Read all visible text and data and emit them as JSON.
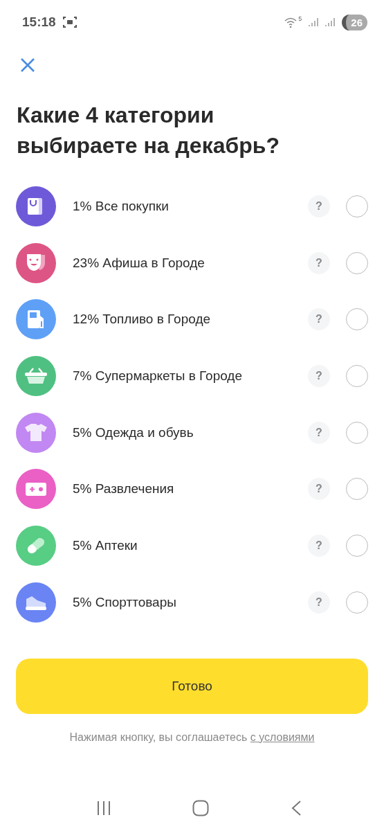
{
  "status_bar": {
    "time": "15:18",
    "network_badge": "5",
    "battery": "26"
  },
  "title": "Какие 4 категории выбираете на декабрь?",
  "categories": [
    {
      "kind": "bag",
      "color": "#6e5ad8",
      "label": "1% Все покупки",
      "help": "?",
      "selected": false
    },
    {
      "kind": "mask",
      "color": "#dd5585",
      "label": "23% Афиша в Городе",
      "help": "?",
      "selected": false
    },
    {
      "kind": "fuel",
      "color": "#5fa0f7",
      "label": "12% Топливо в Городе",
      "help": "?",
      "selected": false
    },
    {
      "kind": "basket",
      "color": "#4fc081",
      "label": "7% Супермаркеты в Городе",
      "help": "?",
      "selected": false
    },
    {
      "kind": "shirt",
      "color": "#c187f2",
      "label": "5% Одежда и обувь",
      "help": "?",
      "selected": false
    },
    {
      "kind": "gamepad",
      "color": "#ea60c5",
      "label": "5% Развлечения",
      "help": "?",
      "selected": false
    },
    {
      "kind": "pill",
      "color": "#58cd84",
      "label": "5% Аптеки",
      "help": "?",
      "selected": false
    },
    {
      "kind": "sneaker",
      "color": "#6a84f4",
      "label": "5% Спорттовары",
      "help": "?",
      "selected": false
    }
  ],
  "done_button": "Готово",
  "footnote": {
    "text": "Нажимая кнопку, вы соглашаетесь",
    "link": "с условиями"
  }
}
